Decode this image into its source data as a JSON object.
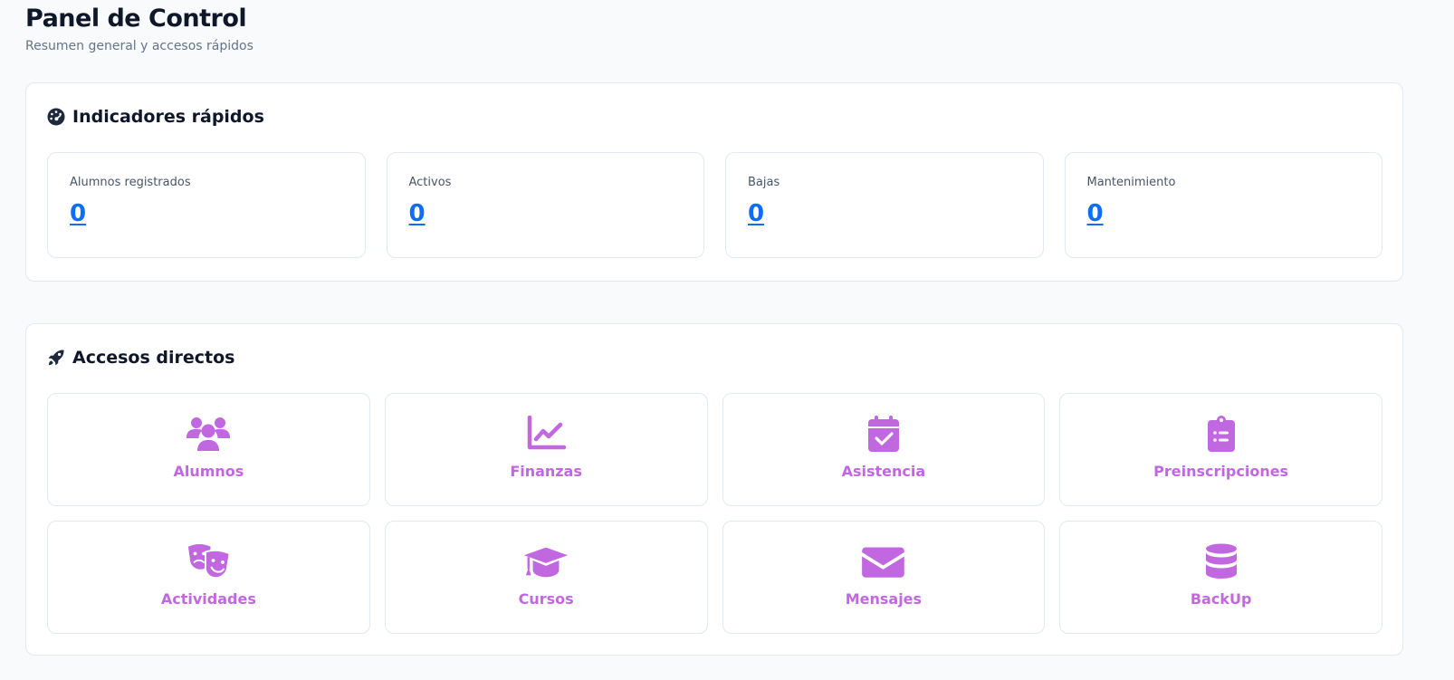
{
  "header": {
    "title": "Panel de Control",
    "subtitle": "Resumen general y accesos rápidos"
  },
  "indicators": {
    "title": "Indicadores rápidos",
    "icon": "gauge-icon",
    "items": [
      {
        "label": "Alumnos registrados",
        "value": "0"
      },
      {
        "label": "Activos",
        "value": "0"
      },
      {
        "label": "Bajas",
        "value": "0"
      },
      {
        "label": "Mantenimiento",
        "value": "0"
      }
    ]
  },
  "shortcuts": {
    "title": "Accesos directos",
    "icon": "rocket-icon",
    "accent_color": "#c167e0",
    "items": [
      {
        "label": "Alumnos",
        "icon": "users-icon"
      },
      {
        "label": "Finanzas",
        "icon": "chart-line-icon"
      },
      {
        "label": "Asistencia",
        "icon": "calendar-check-icon"
      },
      {
        "label": "Preinscripciones",
        "icon": "clipboard-list-icon"
      },
      {
        "label": "Actividades",
        "icon": "masks-theater-icon"
      },
      {
        "label": "Cursos",
        "icon": "graduation-cap-icon"
      },
      {
        "label": "Mensajes",
        "icon": "envelope-icon"
      },
      {
        "label": "BackUp",
        "icon": "database-icon"
      }
    ]
  },
  "colors": {
    "link": "#0d6efd",
    "background": "#f8fafc",
    "title": "#0f172a"
  }
}
